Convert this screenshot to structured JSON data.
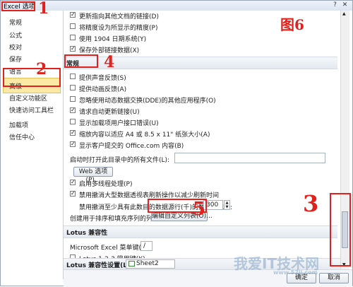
{
  "window": {
    "title": "Excel 选项"
  },
  "sidebar": {
    "items": [
      {
        "label": "常规"
      },
      {
        "label": "公式"
      },
      {
        "label": "校对"
      },
      {
        "label": "保存"
      },
      {
        "label": "语言"
      },
      {
        "label": "高级"
      },
      {
        "label": "自定义功能区"
      },
      {
        "label": "快速访问工具栏"
      },
      {
        "label": "加载项"
      },
      {
        "label": "信任中心"
      }
    ],
    "selected": "高级"
  },
  "top_options": [
    {
      "label": "更新指向其他文档的链接(D)",
      "checked": true
    },
    {
      "label": "将精度设为所显示的精度(P)",
      "checked": false
    },
    {
      "label": "使用 1904 日期系统(Y)",
      "checked": false
    },
    {
      "label": "保存外部链接数据(X)",
      "checked": true
    }
  ],
  "general_section": {
    "title": "常规",
    "options": [
      {
        "label": "提供声音反馈(S)",
        "checked": false
      },
      {
        "label": "提供动画反馈(A)",
        "checked": false
      },
      {
        "label": "忽略使用动态数据交换(DDE)的其他应用程序(O)",
        "checked": false
      },
      {
        "label": "请求自动更新链接(U)",
        "checked": true
      },
      {
        "label": "显示加载项用户接口错误(U)",
        "checked": false
      },
      {
        "label": "缩放内容以适应 A4 或 8.5 x 11\" 纸张大小(A)",
        "checked": true
      },
      {
        "label": "显示客户提交的 Office.com 内容(B)",
        "checked": true
      }
    ],
    "startup_label": "启动时打开此目录中的所有文件(L):",
    "startup_value": "",
    "web_options_button": "Web 选项(P)...",
    "multithread_label": "启用多线程处理(P)",
    "multithread_checked": true,
    "pivot_undo_label": "禁用撤消大型数据透视表刷新操作以减少刷新时间",
    "pivot_undo_checked": true,
    "pivot_rows_label": "禁用撤消至少具有此数目的数据源行(千)的数据透视表:",
    "pivot_rows_value": "300",
    "custom_list_label": "创建用于排序和填充序列的列表:",
    "custom_list_button": "编辑自定义列表(O)..."
  },
  "lotus_section": {
    "title": "Lotus 兼容性",
    "menu_key_label": "Microsoft Excel 菜单键(M):",
    "menu_key_value": "/",
    "nav_keys_label": "Lotus 1-2-3 常用键(K)",
    "nav_keys_checked": false
  },
  "lotus_settings": {
    "label": "Lotus 兼容性设置(L):",
    "sheet_value": "Sheet2"
  },
  "footer": {
    "ok_label": "确定",
    "cancel_label": "取消"
  },
  "annotations": {
    "fig": "图6",
    "n1": "1",
    "n2": "2",
    "n3": "3",
    "n4": "4",
    "n5": "5"
  },
  "watermark": {
    "main": "我爱IT技术网",
    "sub": "www.52ij.com"
  },
  "colors": {
    "annotation": "#e2201c",
    "selection": "#fde9a6",
    "section_bg": "#e4e9f0"
  }
}
